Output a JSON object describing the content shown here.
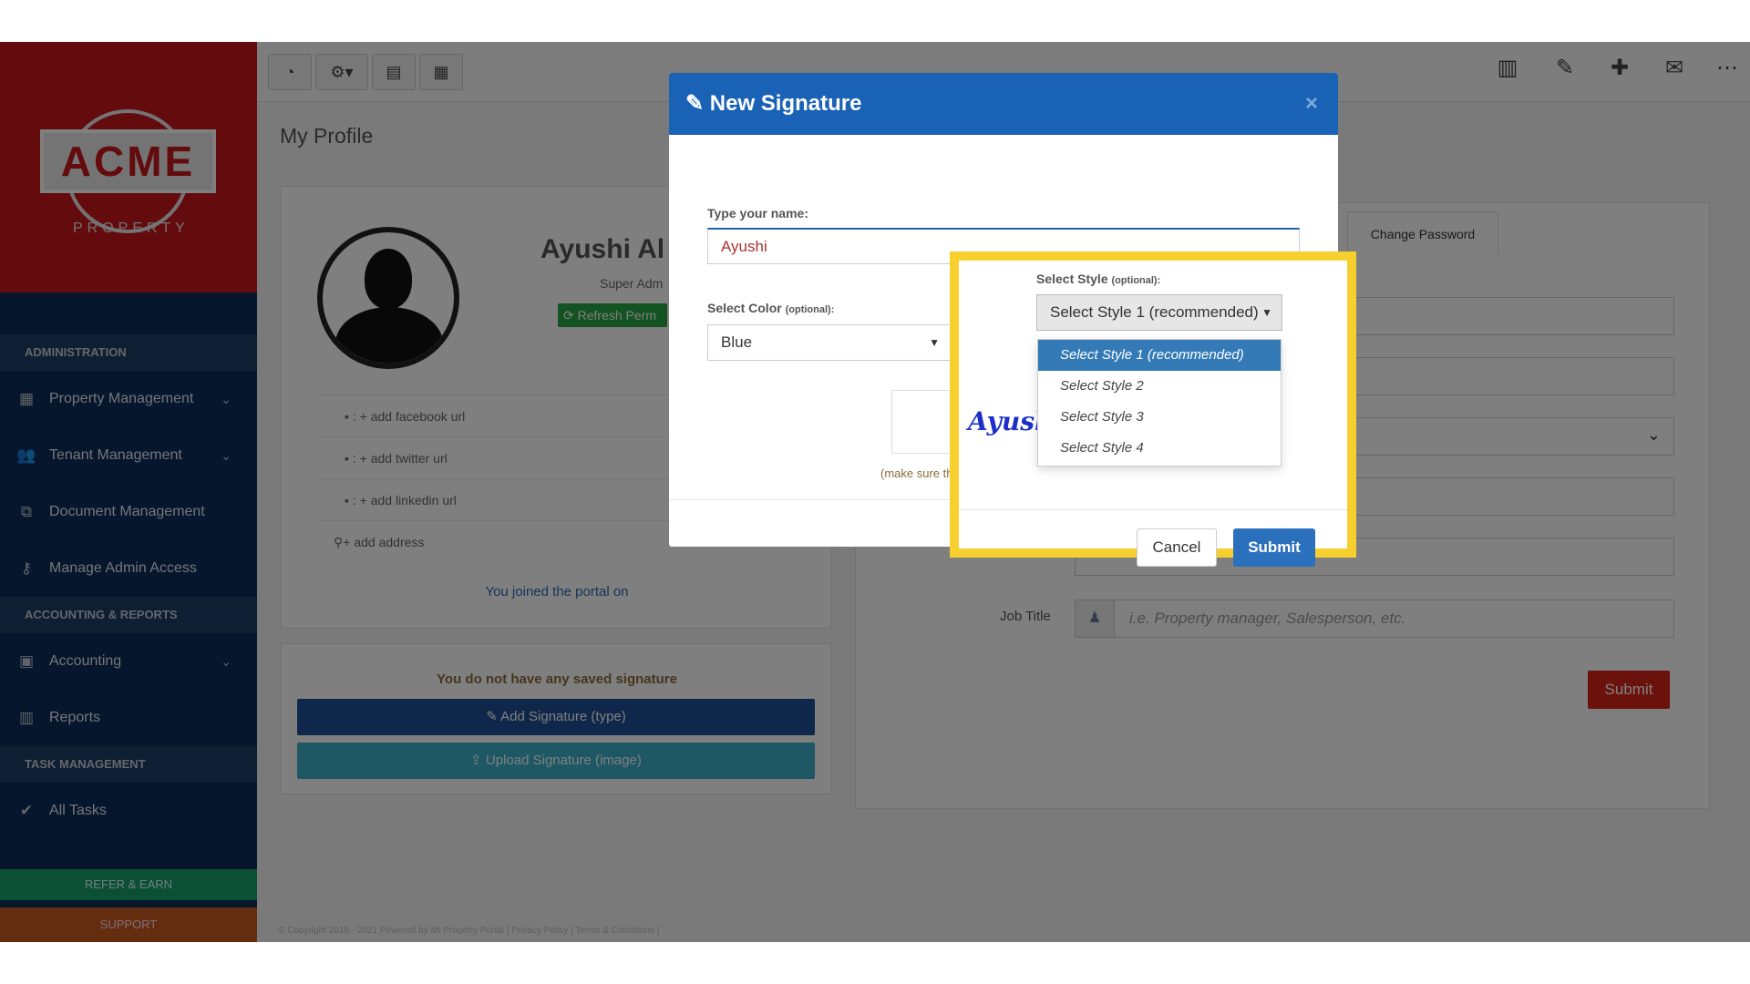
{
  "sidebar": {
    "logo_text": "ACME",
    "logo_sub": "PROPERTY",
    "sections": [
      {
        "header": "ADMINISTRATION"
      },
      {
        "header": "ACCOUNTING & REPORTS"
      },
      {
        "header": "TASK MANAGEMENT"
      }
    ],
    "items": [
      {
        "label": "Property Management",
        "icon": "building-icon"
      },
      {
        "label": "Tenant Management",
        "icon": "users-icon"
      },
      {
        "label": "Document Management",
        "icon": "copy-icon"
      },
      {
        "label": "Manage Admin Access",
        "icon": "key-icon"
      },
      {
        "label": "Accounting",
        "icon": "money-icon"
      },
      {
        "label": "Reports",
        "icon": "bar-chart-icon"
      },
      {
        "label": "All Tasks",
        "icon": "check-icon"
      }
    ],
    "refer": "REFER & EARN",
    "support": "SUPPORT"
  },
  "page": {
    "title": "My Profile"
  },
  "profile": {
    "name": "Ayushi Al",
    "role": "Super Adm",
    "refresh_label": "Refresh Perm",
    "social": [
      {
        "label": "+ add facebook url"
      },
      {
        "label": "+ add twitter url"
      },
      {
        "label": "+ add linkedin url"
      },
      {
        "label": "+ add address"
      }
    ],
    "joined": "You joined the portal on"
  },
  "signature_card": {
    "none_text": "You do not have any saved signature",
    "add_label": "Add Signature (type)",
    "upload_label": "Upload Signature (image)"
  },
  "form": {
    "tab_change_password": "Change Password",
    "job_title_label": "Job Title",
    "job_title_placeholder": "i.e. Property manager, Salesperson, etc.",
    "submit_label": "Submit"
  },
  "footer": {
    "text": "© Copyright 2019 - 2021 Powered by MI Property Portal | Privacy Policy | Terms & Conditions |"
  },
  "modal": {
    "title": "New Signature",
    "close": "×",
    "name_label": "Type your name:",
    "name_value": "Ayushi",
    "color_label": "Select Color",
    "color_optional": "(optional):",
    "color_value": "Blue",
    "style_label": "Select Style",
    "style_optional": "(optional):",
    "style_value": "Select Style 1 (recommended)",
    "style_options": [
      "Select Style 1 (recommended)",
      "Select Style 2",
      "Select Style 3",
      "Select Style 4"
    ],
    "preview_text": "Ayushi",
    "make_sure": "(make sure the text stays",
    "cancel_label": "Cancel",
    "submit_label": "Submit"
  },
  "colors": {
    "brand_red": "#c8161d",
    "sidebar_navy": "#0c2d5a",
    "modal_blue": "#1a62b5",
    "highlight_yellow": "#f7cf2f",
    "selected_blue": "#337ab7"
  }
}
